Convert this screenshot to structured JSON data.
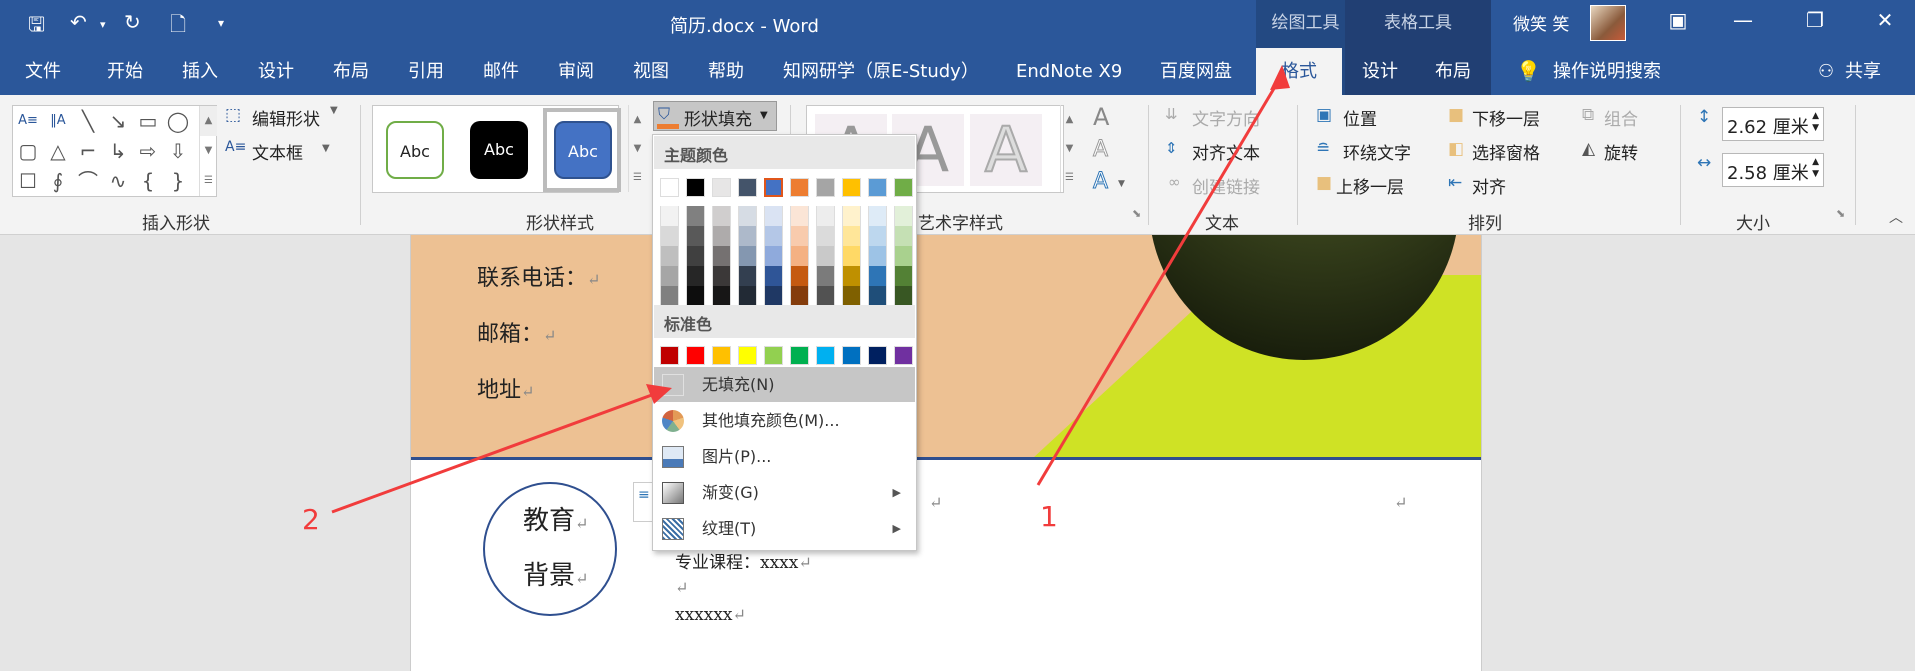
{
  "titlebar": {
    "title": "简历.docx  -  Word",
    "context_groups": [
      "绘图工具",
      "表格工具"
    ],
    "user": "微笑 笑",
    "quick_access": {
      "save": "save-icon",
      "undo": "undo-icon",
      "redo": "redo-icon",
      "new": "new-doc-icon",
      "customize": "customize-icon"
    },
    "window_buttons": {
      "ribbon_display": "▣",
      "minimize": "—",
      "restore": "❐",
      "close": "✕"
    }
  },
  "tabs": [
    "文件",
    "开始",
    "插入",
    "设计",
    "布局",
    "引用",
    "邮件",
    "审阅",
    "视图",
    "帮助",
    "知网研学（原E-Study）",
    "EndNote X9",
    "百度网盘",
    "格式",
    "设计",
    "布局"
  ],
  "active_tab": "格式",
  "tell_me": "操作说明搜索",
  "share": "共享",
  "ribbon": {
    "insert_shapes": {
      "label": "插入形状",
      "edit_shape": "编辑形状",
      "text_box": "文本框"
    },
    "shape_styles": {
      "label": "形状样式",
      "preset_text": "Abc",
      "shape_fill": "形状填充"
    },
    "wordart_styles": {
      "label": "艺术字样式"
    },
    "text": {
      "label": "文本",
      "text_direction": "文字方向",
      "align_text": "对齐文本",
      "create_link": "创建链接"
    },
    "arrange": {
      "label": "排列",
      "position": "位置",
      "wrap_text": "环绕文字",
      "bring_forward": "上移一层",
      "send_backward": "下移一层",
      "selection_pane": "选择窗格",
      "align": "对齐",
      "group": "组合",
      "rotate": "旋转"
    },
    "size": {
      "label": "大小",
      "height": "2.62 厘米",
      "width": "2.58 厘米"
    }
  },
  "fill_menu": {
    "theme_colors_label": "主题颜色",
    "theme_colors": [
      "#ffffff",
      "#000000",
      "#e7e6e6",
      "#44546a",
      "#4472c4",
      "#ed7d31",
      "#a5a5a5",
      "#ffc000",
      "#5b9bd5",
      "#70ad47"
    ],
    "theme_shades": [
      [
        "#f2f2f2",
        "#d9d9d9",
        "#bfbfbf",
        "#a6a6a6",
        "#808080"
      ],
      [
        "#808080",
        "#595959",
        "#404040",
        "#262626",
        "#0d0d0d"
      ],
      [
        "#d0cece",
        "#aeabab",
        "#757171",
        "#3b3838",
        "#171616"
      ],
      [
        "#d6dce4",
        "#adb9ca",
        "#8497b0",
        "#333f50",
        "#222a35"
      ],
      [
        "#dae3f3",
        "#b4c7e7",
        "#8faadc",
        "#2f5597",
        "#1f3864"
      ],
      [
        "#fbe5d6",
        "#f8cbad",
        "#f4b183",
        "#c55a11",
        "#843c0c"
      ],
      [
        "#ededed",
        "#dbdbdb",
        "#c9c9c9",
        "#7b7b7b",
        "#525252"
      ],
      [
        "#fff2cc",
        "#ffe699",
        "#ffd966",
        "#bf9000",
        "#7f6000"
      ],
      [
        "#deebf7",
        "#bdd7ee",
        "#9dc3e6",
        "#2e75b6",
        "#1f4e79"
      ],
      [
        "#e2f0d9",
        "#c5e0b4",
        "#a9d18e",
        "#538135",
        "#385723"
      ]
    ],
    "standard_colors_label": "标准色",
    "standard_colors": [
      "#c00000",
      "#ff0000",
      "#ffc000",
      "#ffff00",
      "#92d050",
      "#00b050",
      "#00b0f0",
      "#0070c0",
      "#002060",
      "#7030a0"
    ],
    "items": [
      {
        "label": "无填充(N)",
        "icon": "no-fill-icon"
      },
      {
        "label": "其他填充颜色(M)...",
        "icon": "color-wheel-icon"
      },
      {
        "label": "图片(P)...",
        "icon": "picture-icon"
      },
      {
        "label": "渐变(G)",
        "icon": "gradient-icon",
        "submenu": true
      },
      {
        "label": "纹理(T)",
        "icon": "texture-icon",
        "submenu": true
      }
    ]
  },
  "document": {
    "contact_lines": [
      "联系电话：",
      "邮箱：",
      "地址"
    ],
    "circle_text": [
      "教育",
      "背景"
    ],
    "course_line": "专业课程：xxxx",
    "blank_line": "",
    "xline": "xxxxxx",
    "para_mark": "↵",
    "header_color": "#edc193",
    "accent_color": "#cfe225"
  },
  "annotations": [
    "1",
    "2"
  ]
}
